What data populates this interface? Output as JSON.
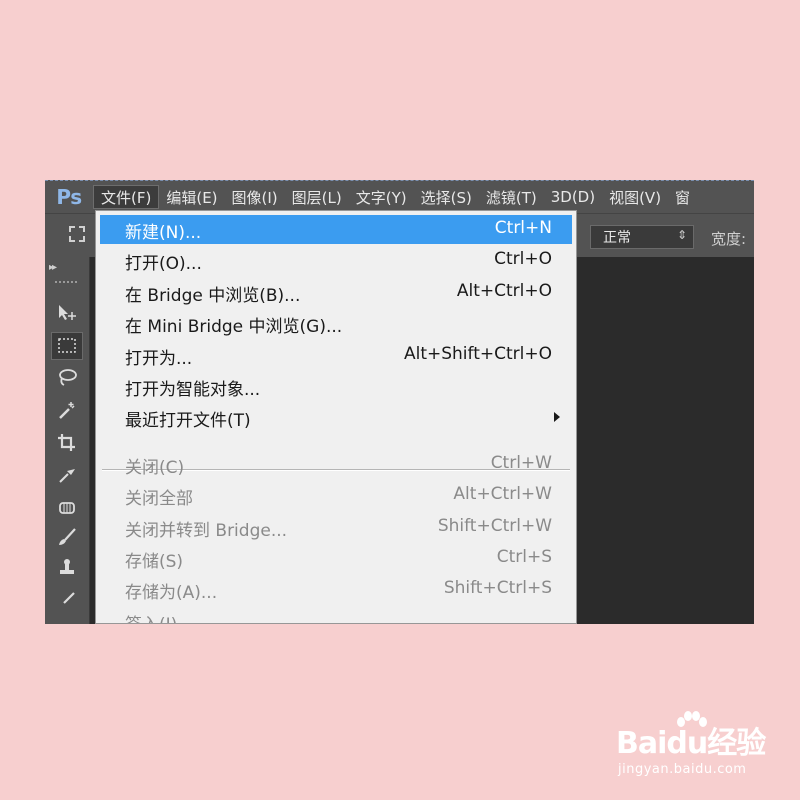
{
  "app": {
    "logo": "Ps",
    "menu": [
      {
        "label": "文件(F)",
        "active": true
      },
      {
        "label": "编辑(E)"
      },
      {
        "label": "图像(I)"
      },
      {
        "label": "图层(L)"
      },
      {
        "label": "文字(Y)"
      },
      {
        "label": "选择(S)"
      },
      {
        "label": "滤镜(T)"
      },
      {
        "label": "3D(D)"
      },
      {
        "label": "视图(V)"
      },
      {
        "label": "窗"
      }
    ]
  },
  "options_bar": {
    "mode_value": "正常",
    "width_label": "宽度:"
  },
  "toolbar": {
    "tools": [
      {
        "name": "move-tool-icon",
        "selected": false
      },
      {
        "name": "rectangular-marquee-tool-icon",
        "selected": true
      },
      {
        "name": "lasso-tool-icon",
        "selected": false
      },
      {
        "name": "magic-wand-tool-icon",
        "selected": false
      },
      {
        "name": "crop-tool-icon",
        "selected": false
      },
      {
        "name": "eyedropper-tool-icon",
        "selected": false
      },
      {
        "name": "spot-healing-tool-icon",
        "selected": false
      },
      {
        "name": "brush-tool-icon",
        "selected": false
      },
      {
        "name": "clone-stamp-tool-icon",
        "selected": false
      },
      {
        "name": "history-brush-tool-icon",
        "selected": false
      }
    ]
  },
  "file_menu": {
    "items": [
      {
        "label": "新建(N)...",
        "shortcut": "Ctrl+N",
        "highlighted": true
      },
      {
        "label": "打开(O)...",
        "shortcut": "Ctrl+O"
      },
      {
        "label": "在 Bridge 中浏览(B)...",
        "shortcut": "Alt+Ctrl+O"
      },
      {
        "label": "在 Mini Bridge 中浏览(G)...",
        "shortcut": ""
      },
      {
        "label": "打开为...",
        "shortcut": "Alt+Shift+Ctrl+O"
      },
      {
        "label": "打开为智能对象...",
        "shortcut": ""
      },
      {
        "label": "最近打开文件(T)",
        "shortcut": "",
        "submenu": true
      },
      {
        "label": "关闭(C)",
        "shortcut": "Ctrl+W",
        "disabled": true
      },
      {
        "label": "关闭全部",
        "shortcut": "Alt+Ctrl+W",
        "disabled": true
      },
      {
        "label": "关闭并转到 Bridge...",
        "shortcut": "Shift+Ctrl+W",
        "disabled": true
      },
      {
        "label": "存储(S)",
        "shortcut": "Ctrl+S",
        "disabled": true
      },
      {
        "label": "存储为(A)...",
        "shortcut": "Shift+Ctrl+S",
        "disabled": true
      },
      {
        "label": "签入(I)",
        "shortcut": "",
        "disabled": true
      }
    ]
  },
  "watermark": {
    "logo": "Baidu经验",
    "url": "jingyan.baidu.com"
  },
  "colors": {
    "page_background": "#f7cfcf",
    "ui_panel": "#535353",
    "canvas": "#2b2b2b",
    "menu_highlight": "#3b9cf0",
    "menu_background": "#f0f0f0"
  }
}
